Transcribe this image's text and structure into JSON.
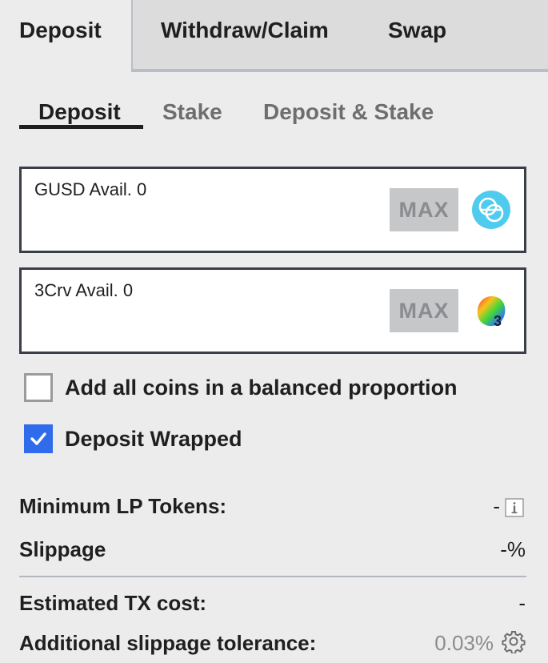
{
  "top_tabs": [
    {
      "label": "Deposit",
      "active": true
    },
    {
      "label": "Withdraw/Claim",
      "active": false
    },
    {
      "label": "Swap",
      "active": false
    }
  ],
  "sub_tabs": [
    {
      "label": "Deposit",
      "active": true
    },
    {
      "label": "Stake",
      "active": false
    },
    {
      "label": "Deposit & Stake",
      "active": false
    }
  ],
  "coins": [
    {
      "label": "GUSD Avail. 0",
      "value": "",
      "max_label": "MAX",
      "icon": "gusd-coin-icon"
    },
    {
      "label": "3Crv Avail. 0",
      "value": "",
      "max_label": "MAX",
      "icon": "3crv-coin-icon"
    }
  ],
  "options": {
    "balanced": {
      "label": "Add all coins in a balanced proportion",
      "checked": false
    },
    "wrapped": {
      "label": "Deposit Wrapped",
      "checked": true
    }
  },
  "info": {
    "min_lp": {
      "label": "Minimum LP Tokens:",
      "value": "-"
    },
    "slippage": {
      "label": "Slippage",
      "value": "-%"
    },
    "tx_cost": {
      "label": "Estimated TX cost:",
      "value": "-"
    },
    "slippage_tolerance": {
      "label": "Additional slippage tolerance:",
      "value": "0.03%"
    }
  },
  "colors": {
    "accent": "#2f6bea",
    "gusd": "#4fcbee",
    "background": "#ececec"
  }
}
